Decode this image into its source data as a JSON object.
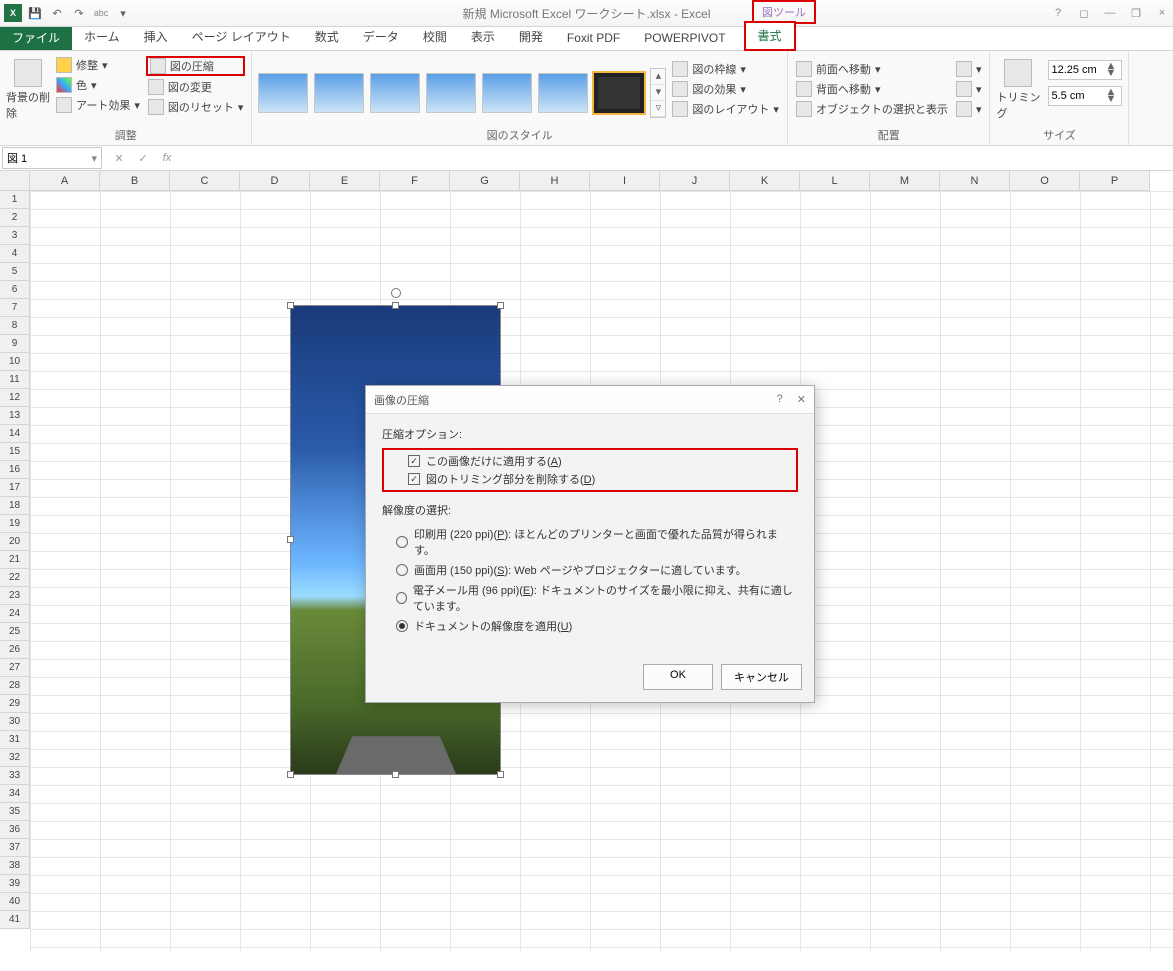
{
  "title": "新規 Microsoft Excel ワークシート.xlsx - Excel",
  "picture_tools": "図ツール",
  "qat_labels": {
    "save": "保存",
    "undo": "元に戻す",
    "redo": "やり直し",
    "chkabc": "abc"
  },
  "syswin": {
    "help": "?",
    "opts": "◻",
    "min": "—",
    "rest": "❐",
    "close": "×"
  },
  "tabs": {
    "file": "ファイル",
    "home": "ホーム",
    "insert": "挿入",
    "pagelayout": "ページ レイアウト",
    "formulas": "数式",
    "data": "データ",
    "review": "校閲",
    "view": "表示",
    "developer": "開発",
    "foxit": "Foxit PDF",
    "powerpivot": "POWERPIVOT",
    "format": "書式"
  },
  "ribbon": {
    "adjust": {
      "remove_bg": "背景の削除",
      "corrections": "修整",
      "color": "色",
      "artistic": "アート効果",
      "compress": "図の圧縮",
      "change": "図の変更",
      "reset": "図のリセット",
      "label": "調整"
    },
    "styles": {
      "border": "図の枠線",
      "effects": "図の効果",
      "layout": "図のレイアウト",
      "label": "図のスタイル"
    },
    "arrange": {
      "forward": "前面へ移動",
      "backward": "背面へ移動",
      "selection": "オブジェクトの選択と表示",
      "label": "配置"
    },
    "size": {
      "crop": "トリミング",
      "h": "12.25 cm",
      "w": "5.5 cm",
      "label": "サイズ"
    }
  },
  "namebox": "図 1",
  "fx_label": "fx",
  "columns": [
    "A",
    "B",
    "C",
    "D",
    "E",
    "F",
    "G",
    "H",
    "I",
    "J",
    "K",
    "L",
    "M",
    "N",
    "O",
    "P"
  ],
  "rowcount": 41,
  "dialog": {
    "title": "画像の圧縮",
    "sect1": "圧縮オプション:",
    "chk_apply": "この画像だけに適用する(",
    "chk_apply_key": "A",
    "chk_delete": "図のトリミング部分を削除する(",
    "chk_delete_key": "D",
    "sect2": "解像度の選択:",
    "r1": "印刷用 (220 ppi)(",
    "r1k": "P",
    "r1t": "): ほとんどのプリンターと画面で優れた品質が得られます。",
    "r2": "画面用 (150 ppi)(",
    "r2k": "S",
    "r2t": "): Web ページやプロジェクターに適しています。",
    "r3": "電子メール用 (96 ppi)(",
    "r3k": "E",
    "r3t": "): ドキュメントのサイズを最小限に抑え、共有に適しています。",
    "r4": "ドキュメントの解像度を適用(",
    "r4k": "U",
    "r4t": ")",
    "ok": "OK",
    "cancel": "キャンセル"
  }
}
